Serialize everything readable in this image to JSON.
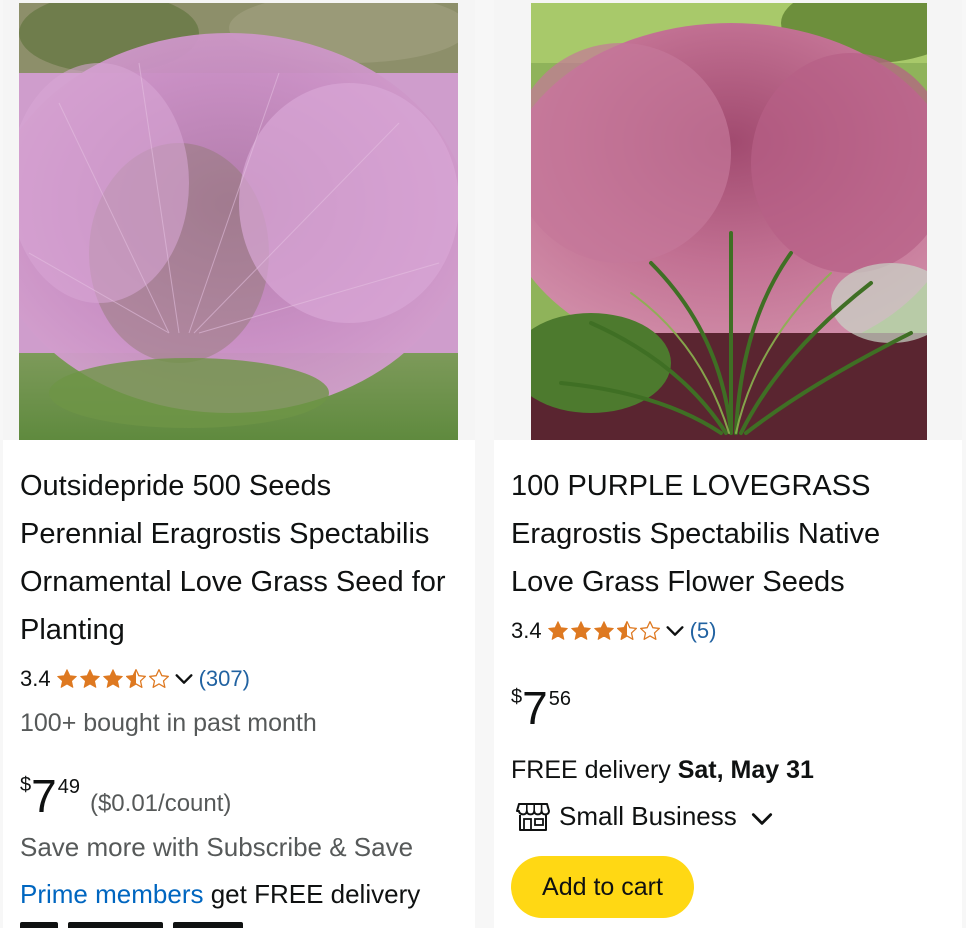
{
  "products": [
    {
      "image_alt": "Pink muhly ornamental grass",
      "title": "Outsidepride 500 Seeds Perennial Eragrostis Spectabilis Ornamental Love Grass Seed for Planting",
      "rating": "3.4",
      "stars": 3.5,
      "review_count": "(307)",
      "bought": "100+ bought in past month",
      "price": {
        "symbol": "$",
        "whole": "7",
        "fraction": "49"
      },
      "unit_price": "($0.01/count)",
      "subscribe": "Save more with Subscribe & Save",
      "prime_link": "Prime members",
      "prime_text": " get FREE delivery"
    },
    {
      "image_alt": "Purple lovegrass plant",
      "title": "100 PURPLE LOVEGRASS Eragrostis Spectabilis Native Love Grass Flower Seeds",
      "rating": "3.4",
      "stars": 3.5,
      "review_count": "(5)",
      "price": {
        "symbol": "$",
        "whole": "7",
        "fraction": "56"
      },
      "delivery_prefix": "FREE delivery ",
      "delivery_date": "Sat, May 31",
      "badge": "Small Business",
      "add_to_cart": "Add to cart"
    }
  ],
  "colors": {
    "star": "#de7921",
    "link": "#2162a1",
    "prime_link": "#0066c0",
    "button": "#ffd814",
    "muted": "#565959"
  },
  "icons": [
    "star-icon",
    "chevron-down-icon",
    "small-business-store-icon"
  ]
}
